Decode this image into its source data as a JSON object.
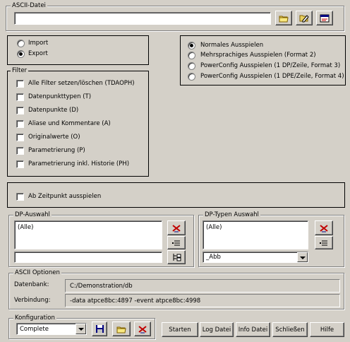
{
  "ascii_datei": {
    "title": "ASCII-Datei",
    "value": ""
  },
  "direction": {
    "import": "Import",
    "export": "Export",
    "selected": "export"
  },
  "mode": {
    "options": [
      "Normales Ausspielen",
      "Mehrsprachiges Ausspielen (Format 2)",
      "PowerConfig Ausspielen (1 DP/Zeile, Format 3)",
      "PowerConfig Ausspielen (1 DPE/Zeile, Format 4)"
    ],
    "selected_index": 0
  },
  "filter": {
    "title": "Filter",
    "items": [
      "Alle Filter setzen/löschen (TDAOPH)",
      "Datenpunkttypen (T)",
      "Datenpunkte (D)",
      "Aliase und Kommentare (A)",
      "Originalwerte (O)",
      "Parametrierung (P)",
      "Parametrierung inkl. Historie (PH)"
    ]
  },
  "zeitpunkt": {
    "label": "Ab Zeitpunkt ausspielen"
  },
  "dp_auswahl": {
    "title": "DP-Auswahl",
    "items": [
      "(Alle)"
    ],
    "filter_value": ""
  },
  "dp_typen": {
    "title": "DP-Typen Auswahl",
    "items": [
      "(Alle)"
    ],
    "selected": "_Abb"
  },
  "ascii_optionen": {
    "title": "ASCII Optionen",
    "datenbank_label": "Datenbank:",
    "datenbank_value": "C:/Demonstration/db",
    "verbindung_label": "Verbindung:",
    "verbindung_value": "-data atpce8bc:4897 -event atpce8bc:4998"
  },
  "konfiguration": {
    "title": "Konfiguration",
    "selected": "Complete"
  },
  "buttons": {
    "starten": "Starten",
    "log_datei": "Log Datei",
    "info_datei": "Info Datei",
    "schliessen": "Schließen",
    "hilfe": "Hilfe"
  }
}
